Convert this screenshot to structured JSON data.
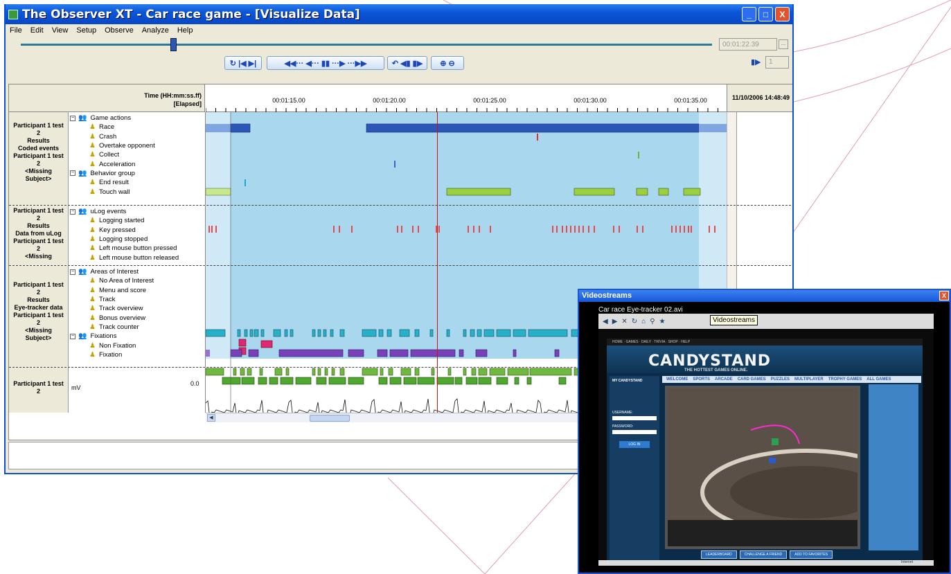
{
  "window": {
    "title": "The Observer XT - Car race game - [Visualize Data]",
    "minimize": "_",
    "maximize": "□",
    "close": "X"
  },
  "menu": [
    "File",
    "Edit",
    "View",
    "Setup",
    "Observe",
    "Analyze",
    "Help"
  ],
  "playback": {
    "time": "00:01:22.39",
    "more_button": "...",
    "frame_step": "1",
    "progress": 0.22
  },
  "toolbar": {
    "group1": "↻ |◀ ▶|",
    "group2": "◀◀··· ◀··· ▮▮ ···▶ ···▶▶",
    "group3": "↶ ◀▮ ▮▶",
    "group4": "⊕ ⊖"
  },
  "timeline": {
    "time_header_line1": "Time (HH:mm:ss.ff)",
    "time_header_line2": "[Elapsed]",
    "ticks": [
      "00:01:15.00",
      "00:01:20.00",
      "00:01:25.00",
      "00:01:30.00",
      "00:01:35.00"
    ],
    "date": "11/10/2006 14:48:49"
  },
  "sections": [
    {
      "source": [
        "Participant 1 test",
        "2",
        "Results",
        "Coded events",
        "Participant 1 test",
        "2",
        "<Missing",
        "Subject>"
      ],
      "rows": [
        {
          "label": "Game actions",
          "group": true
        },
        {
          "label": "Race"
        },
        {
          "label": "Crash"
        },
        {
          "label": "Overtake opponent"
        },
        {
          "label": "Collect"
        },
        {
          "label": "Acceleration"
        },
        {
          "label": "Behavior group",
          "group": true
        },
        {
          "label": "End result"
        },
        {
          "label": "Touch wall"
        }
      ]
    },
    {
      "source": [
        "Participant 1 test",
        "2",
        "Results",
        "Data from uLog",
        "Participant 1 test",
        "2",
        "<Missing"
      ],
      "rows": [
        {
          "label": "uLog events",
          "group": true
        },
        {
          "label": "Logging started"
        },
        {
          "label": "Key pressed"
        },
        {
          "label": "Logging stopped"
        },
        {
          "label": "Left mouse button pressed"
        },
        {
          "label": "Left mouse button released"
        }
      ]
    },
    {
      "source": [
        "Participant 1 test",
        "2",
        "Results",
        "Eye-tracker data",
        "Participant 1 test",
        "2",
        "<Missing",
        "Subject>"
      ],
      "rows": [
        {
          "label": "Areas of Interest",
          "group": true
        },
        {
          "label": "No Area of Interest"
        },
        {
          "label": "Menu and score"
        },
        {
          "label": "Track"
        },
        {
          "label": "Track overview"
        },
        {
          "label": "Bonus overview"
        },
        {
          "label": "Track counter"
        },
        {
          "label": "Fixations",
          "group": true
        },
        {
          "label": "Non Fixation"
        },
        {
          "label": "Fixation"
        }
      ]
    },
    {
      "source": [
        "Participant 1 test",
        "2"
      ],
      "unit": "mV",
      "value": "0.0"
    }
  ],
  "videostreams": {
    "title": "Videostreams",
    "close": "X",
    "file": "Car race Eye-tracker 02.avi",
    "tooltip": "Videostreams",
    "site_logo": "CANDYSTAND",
    "site_tagline": "THE HOTTEST GAMES ONLINE.",
    "nav": [
      "WELCOME",
      "SPORTS",
      "ARCADE",
      "CARD GAMES",
      "PUZZLES",
      "MULTIPLAYER",
      "TROPHY GAMES",
      "ALL GAMES"
    ],
    "sidebar": [
      "MY CANDYSTAND",
      "USERNAME:",
      "PASSWORD:",
      "LOG IN"
    ],
    "buttons": [
      "LEADERBOARD",
      "CHALLENGE A FRIEND",
      "ADD TO FAVORITES"
    ],
    "status": "Internet"
  },
  "colors": {
    "title_bar": "#0a56d8",
    "timeline_bg": "#a9d8ee",
    "current_time_line": "#d01010"
  }
}
